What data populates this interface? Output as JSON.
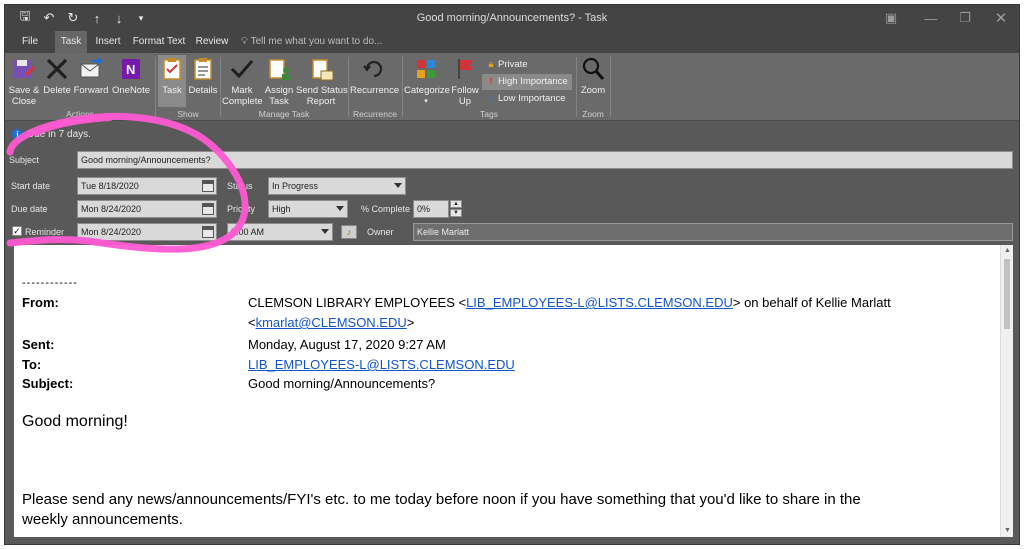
{
  "window": {
    "title": "Good morning/Announcements? - Task"
  },
  "tabs": [
    {
      "label": "File"
    },
    {
      "label": "Task"
    },
    {
      "label": "Insert"
    },
    {
      "label": "Format Text"
    },
    {
      "label": "Review"
    }
  ],
  "tell_me": "Tell me what you want to do...",
  "ribbon": {
    "groups": [
      {
        "label": "Actions"
      },
      {
        "label": "Show"
      },
      {
        "label": "Manage Task"
      },
      {
        "label": "Recurrence"
      },
      {
        "label": "Tags"
      },
      {
        "label": "Zoom"
      }
    ],
    "buttons": {
      "save_close": "Save &\nClose",
      "delete": "Delete",
      "forward": "Forward",
      "onenote": "OneNote",
      "task": "Task",
      "details": "Details",
      "mark_complete": "Mark\nComplete",
      "assign_task": "Assign\nTask",
      "send_status": "Send Status\nReport",
      "recurrence": "Recurrence",
      "categorize": "Categorize",
      "follow_up": "Follow\nUp",
      "private": "Private",
      "high_importance": "High Importance",
      "low_importance": "Low Importance",
      "zoom": "Zoom"
    }
  },
  "info_bar": "Due in 7 days.",
  "form": {
    "subject_label": "Subject",
    "subject_value": "Good morning/Announcements?",
    "start_label": "Start date",
    "start_value": "Tue 8/18/2020",
    "due_label": "Due date",
    "due_value": "Mon 8/24/2020",
    "reminder_label": "Reminder",
    "reminder_checked": true,
    "reminder_date": "Mon 8/24/2020",
    "reminder_time": "9:00 AM",
    "status_label": "Status",
    "status_value": "In Progress",
    "priority_label": "Priority",
    "priority_value": "High",
    "complete_label": "% Complete",
    "complete_value": "0%",
    "owner_label": "Owner",
    "owner_value": "Kellie Marlatt"
  },
  "message": {
    "separator": "------------",
    "from_label": "From:",
    "from_name": "CLEMSON LIBRARY EMPLOYEES <",
    "from_email": "LIB_EMPLOYEES-L@LISTS.CLEMSON.EDU",
    "from_behalf": "> on behalf of Kellie Marlatt",
    "from_email2_open": "<",
    "from_email2": "kmarlat@CLEMSON.EDU",
    "from_email2_close": ">",
    "sent_label": "Sent:",
    "sent_value": "Monday, August 17, 2020 9:27 AM",
    "to_label": "To:",
    "to_value": "LIB_EMPLOYEES-L@LISTS.CLEMSON.EDU",
    "subject_label": "Subject:",
    "subject_value": "Good morning/Announcements?",
    "greeting": "Good morning!",
    "paragraph_line1": "Please send any news/announcements/FYI's etc. to me today before noon if you have something that you'd like to share in the",
    "paragraph_line2": "weekly announcements."
  },
  "colors": {
    "annotation": "#ff5ad2",
    "link": "#1155cc",
    "high_importance": "#d9342b"
  }
}
